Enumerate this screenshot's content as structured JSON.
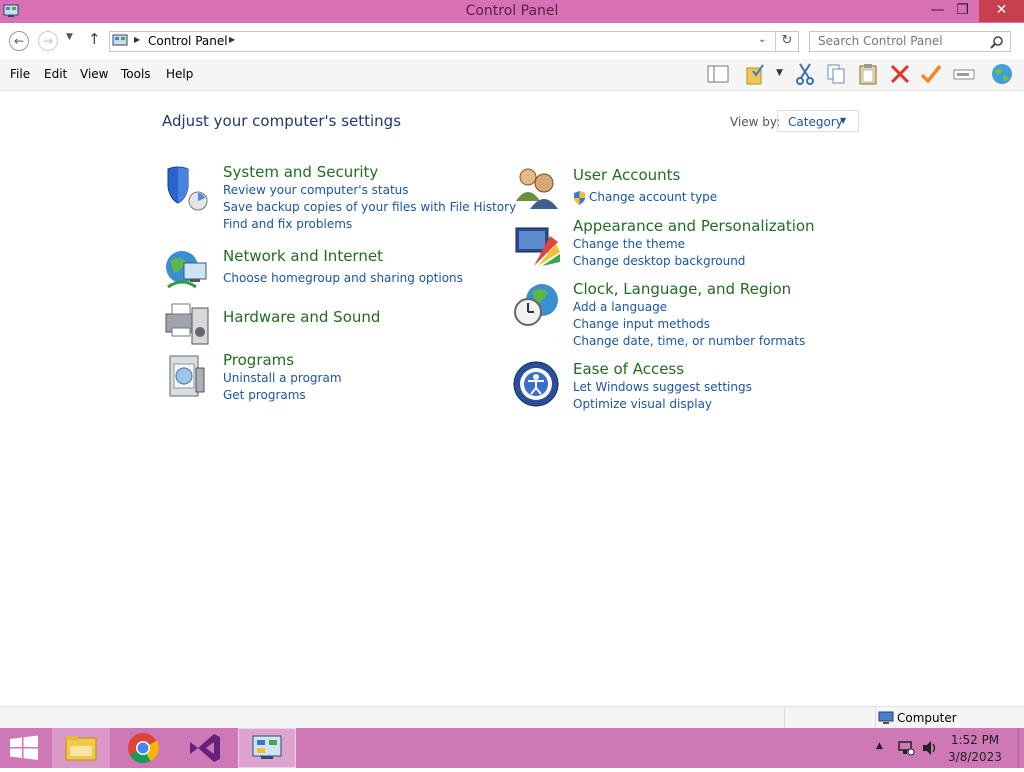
{
  "window": {
    "title": "Control Panel",
    "min_glyph": "—",
    "max_glyph": "❐",
    "close_glyph": "✕"
  },
  "address": {
    "crumb": "Control Panel",
    "search_placeholder": "Search Control Panel"
  },
  "menu": [
    "File",
    "Edit",
    "View",
    "Tools",
    "Help"
  ],
  "content": {
    "heading": "Adjust your computer's settings",
    "view_by_label": "View by:",
    "view_by_value": "Category",
    "left_categories": [
      {
        "title": "System and Security",
        "links": [
          "Review your computer's status",
          "Save backup copies of your files with File History",
          "Find and fix problems"
        ]
      },
      {
        "title": "Network and Internet",
        "links": [
          "Choose homegroup and sharing options"
        ]
      },
      {
        "title": "Hardware and Sound",
        "links": []
      },
      {
        "title": "Programs",
        "links": [
          "Uninstall a program",
          "Get programs"
        ]
      }
    ],
    "right_categories": [
      {
        "title": "User Accounts",
        "links": [
          "Change account type"
        ]
      },
      {
        "title": "Appearance and Personalization",
        "links": [
          "Change the theme",
          "Change desktop background"
        ]
      },
      {
        "title": "Clock, Language, and Region",
        "links": [
          "Add a language",
          "Change input methods",
          "Change date, time, or number formats"
        ]
      },
      {
        "title": "Ease of Access",
        "links": [
          "Let Windows suggest settings",
          "Optimize visual display"
        ]
      }
    ]
  },
  "statusbar": {
    "location": "Computer"
  },
  "taskbar": {
    "time": "1:52 PM",
    "date": "3/8/2023"
  },
  "colors": {
    "titlebar": "#d770b4",
    "taskbar": "#ce78b6",
    "category_title": "#1e6f1e",
    "link": "#1b55a6",
    "close": "#c7404f"
  }
}
